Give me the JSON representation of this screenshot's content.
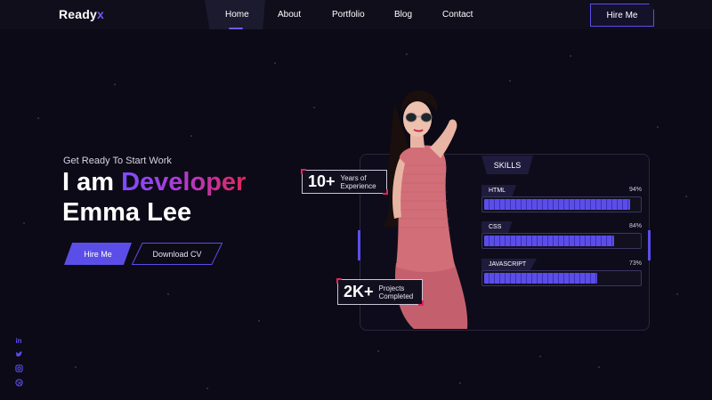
{
  "nav": {
    "logo_main": "Ready",
    "logo_accent": "x",
    "links": [
      "Home",
      "About",
      "Portfolio",
      "Blog",
      "Contact"
    ],
    "active_link": "Home",
    "hire_label": "Hire Me"
  },
  "hero": {
    "tagline": "Get Ready To Start Work",
    "headline_prefix": "I am ",
    "headline_accent": "Developer",
    "name": "Emma Lee",
    "primary_button": "Hire Me",
    "secondary_button": "Download CV"
  },
  "social": {
    "icons": [
      "linkedin-icon",
      "twitter-icon",
      "instagram-icon",
      "dribbble-icon"
    ]
  },
  "stats": [
    {
      "value": "10+",
      "label_line1": "Years of",
      "label_line2": "Experience"
    },
    {
      "value": "2K+",
      "label_line1": "Projects",
      "label_line2": "Completed"
    }
  ],
  "skills": {
    "title": "SKILLS",
    "items": [
      {
        "name": "HTML",
        "percent_label": "94%",
        "percent": 94
      },
      {
        "name": "CSS",
        "percent_label": "84%",
        "percent": 84
      },
      {
        "name": "JAVASCRIPT",
        "percent_label": "73%",
        "percent": 73
      }
    ]
  },
  "colors": {
    "accent": "#5b4ee8",
    "background": "#0c0a16",
    "highlight": "#e0265a"
  }
}
